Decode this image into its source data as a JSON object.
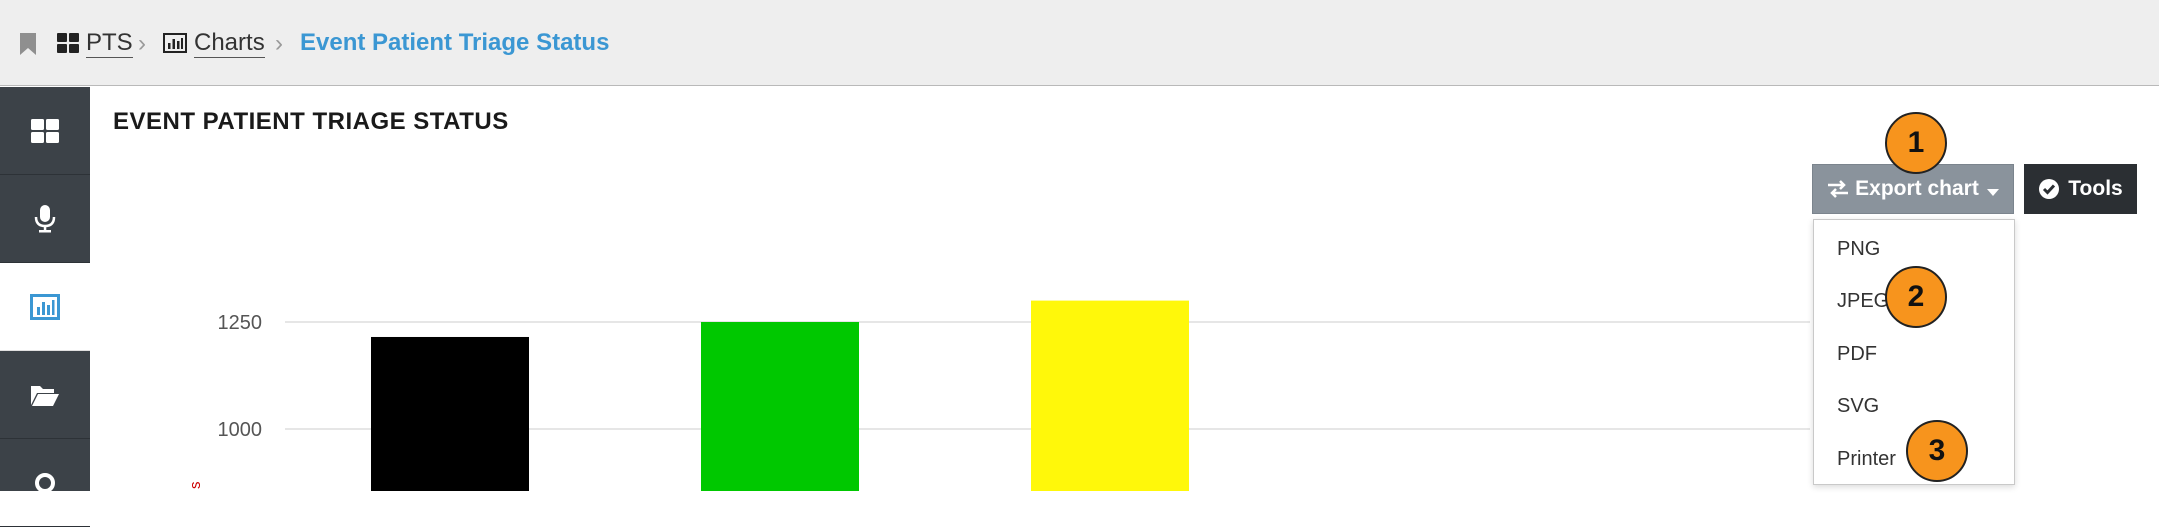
{
  "breadcrumb": {
    "items": [
      {
        "label": "PTS",
        "icon": "dashboard-grid-icon"
      },
      {
        "label": "Charts",
        "icon": "bar-chart-icon"
      }
    ],
    "current": "Event Patient Triage Status"
  },
  "sidebar": {
    "items": [
      {
        "name": "dashboard",
        "icon": "dashboard-grid-icon",
        "active": false
      },
      {
        "name": "microphone",
        "icon": "microphone-icon",
        "active": false
      },
      {
        "name": "charts",
        "icon": "bar-chart-icon",
        "active": true
      },
      {
        "name": "folder",
        "icon": "folder-open-icon",
        "active": false
      },
      {
        "name": "settings",
        "icon": "gear-icon",
        "active": false
      }
    ]
  },
  "page": {
    "title": "EVENT PATIENT TRIAGE STATUS"
  },
  "toolbar": {
    "export_label": "Export chart",
    "tools_label": "Tools"
  },
  "export_menu": {
    "options": [
      "PNG",
      "JPEG",
      "PDF",
      "SVG",
      "Printer"
    ]
  },
  "callouts": [
    "1",
    "2",
    "3"
  ],
  "colors": {
    "accent": "#3b97d3",
    "sidebar": "#3c4248",
    "callout": "#f7941d",
    "export_button": "#8a939c",
    "tools_button": "#2b2f33",
    "axis_label": "#cc0000"
  },
  "chart_data": {
    "type": "bar",
    "y_ticks": [
      1000,
      1250
    ],
    "values": [
      1215,
      1250,
      1300
    ],
    "bar_colors": [
      "#000000",
      "#00c800",
      "#fff80a"
    ],
    "ylabel_fragment": "s",
    "grid": true
  }
}
